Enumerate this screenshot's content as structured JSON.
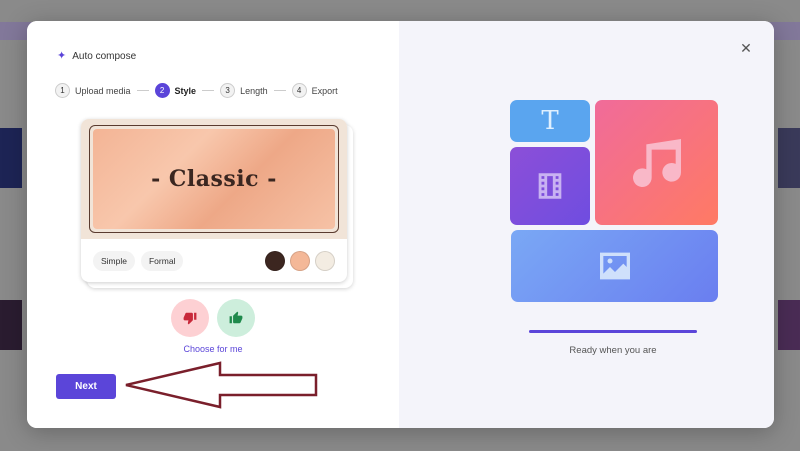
{
  "modal": {
    "title": "Auto compose",
    "steps": [
      {
        "num": "1",
        "label": "Upload media"
      },
      {
        "num": "2",
        "label": "Style",
        "active": true
      },
      {
        "num": "3",
        "label": "Length"
      },
      {
        "num": "4",
        "label": "Export"
      }
    ],
    "style_card": {
      "preview_title": "- Classic -",
      "chips": [
        "Simple",
        "Formal"
      ],
      "swatches": [
        "#3c2620",
        "#f4b898",
        "#f3ece2"
      ]
    },
    "choose_label": "Choose for me",
    "next_label": "Next",
    "close_icon": "close-icon"
  },
  "illustration": {
    "text_tile_glyph": "T",
    "ready_text": "Ready when you are",
    "progress": 1.0
  },
  "colors": {
    "accent": "#5b45d9",
    "annotation": "#7a1f2b"
  }
}
